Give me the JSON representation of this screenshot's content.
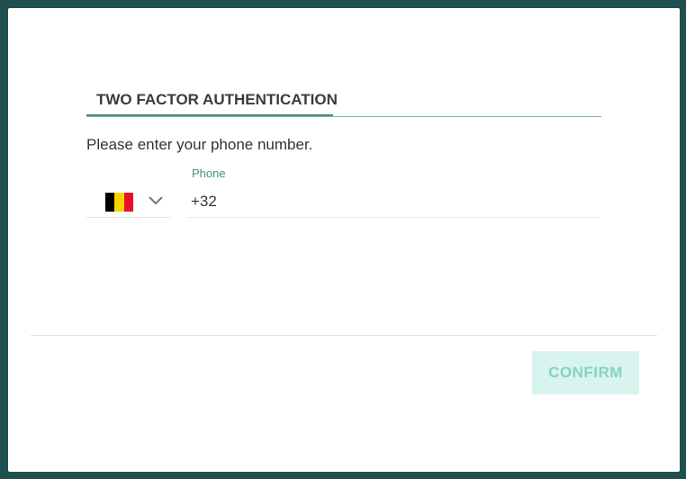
{
  "dialog": {
    "tab": {
      "label": "TWO FACTOR AUTHENTICATION"
    },
    "instruction": "Please enter your phone number.",
    "country_select": {
      "flag_icon": "belgium-flag-icon",
      "flag_colors": [
        "#000000",
        "#f5d400",
        "#e8112d"
      ],
      "dropdown_icon": "chevron-down-icon"
    },
    "phone": {
      "label": "Phone",
      "value": "+32"
    },
    "confirm_label": "CONFIRM"
  },
  "colors": {
    "frame": "#1f4f4e",
    "accent": "#3f8f80",
    "button_bg": "#d9f3ee",
    "button_text": "#84d3c6"
  }
}
